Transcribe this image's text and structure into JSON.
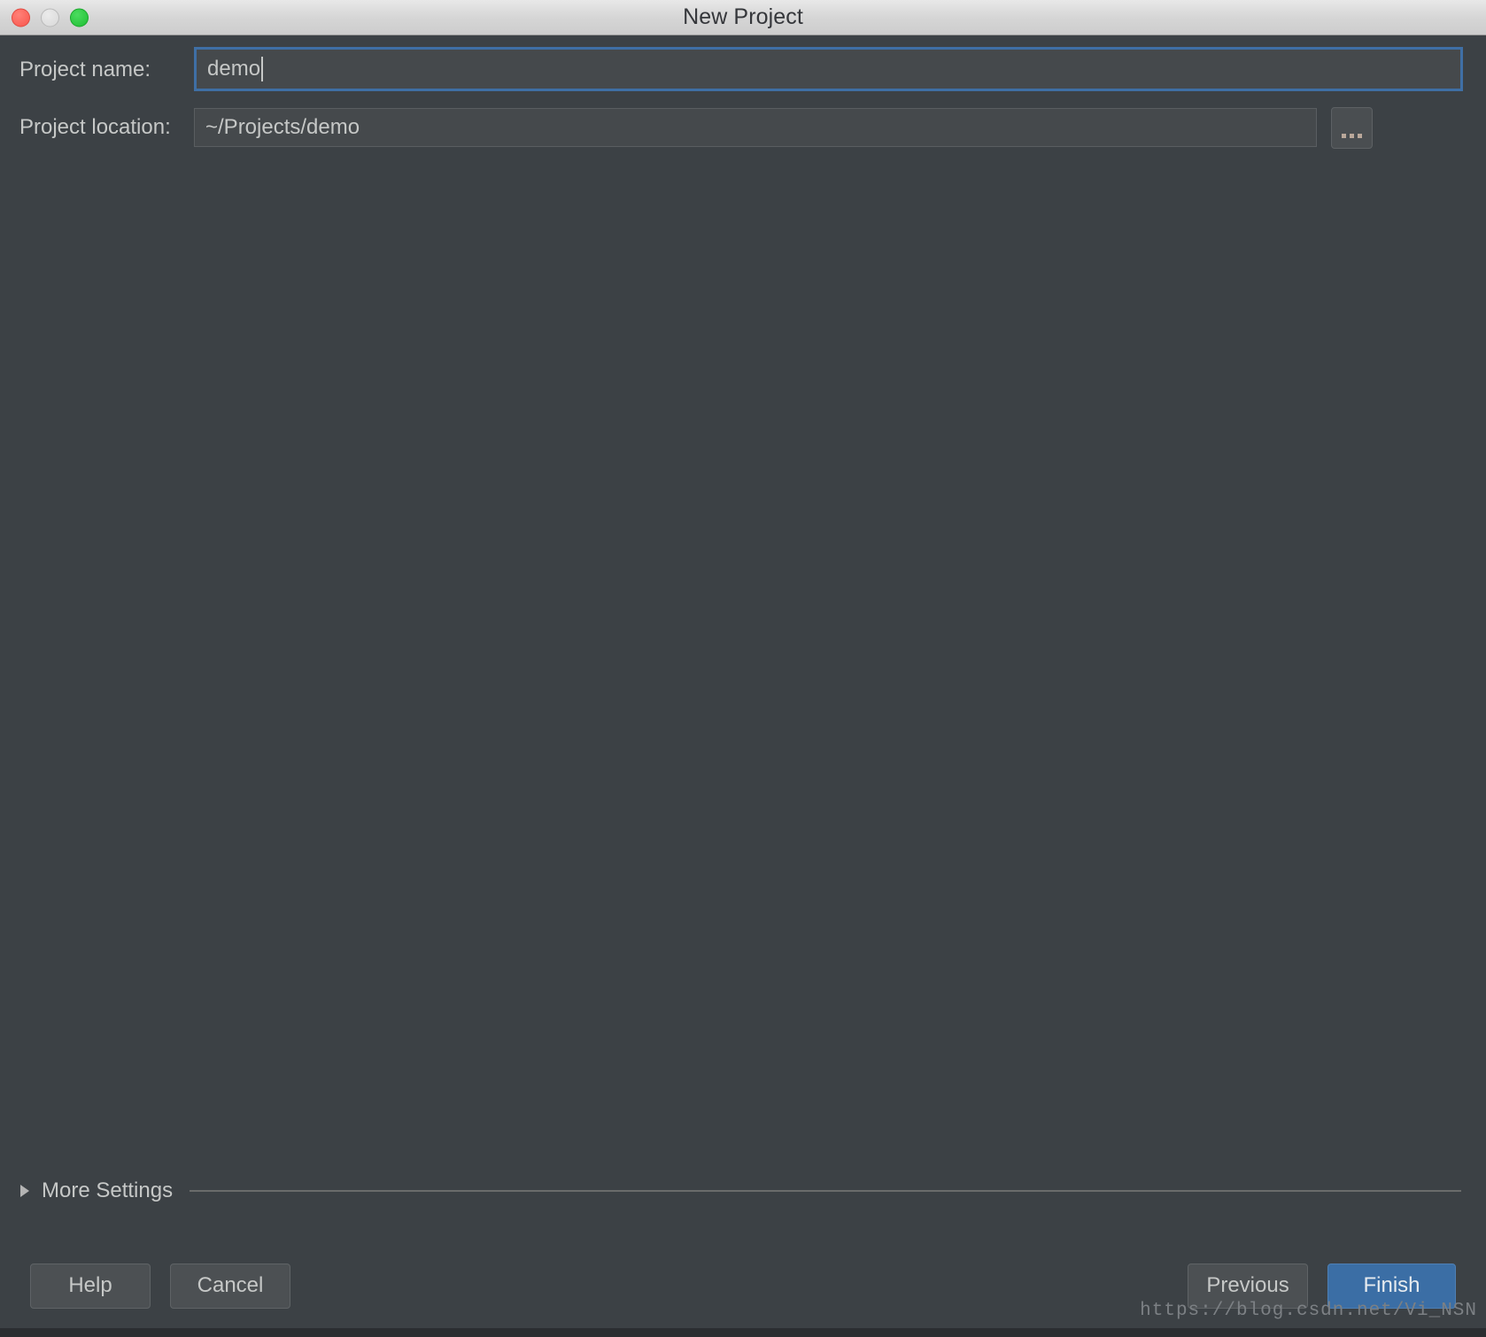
{
  "window": {
    "title": "New Project",
    "traffic_lights": {
      "close_color": "#f9564c",
      "minimize_color": "#dcdcdc",
      "maximize_color": "#28c940"
    }
  },
  "form": {
    "project_name": {
      "label": "Project name:",
      "value": "demo",
      "placeholder": "",
      "focused": true
    },
    "project_location": {
      "label": "Project location:",
      "value": "~/Projects/demo",
      "placeholder": "",
      "browse_label": "..."
    }
  },
  "more_settings": {
    "label": "More Settings",
    "expanded": false
  },
  "buttons": {
    "help": "Help",
    "cancel": "Cancel",
    "previous": "Previous",
    "finish": "Finish"
  },
  "watermark": "https://blog.csdn.net/Vi_NSN",
  "colors": {
    "dialog_background": "#3c4145",
    "field_background": "#45494c",
    "focus_border": "#3f6fa5",
    "primary_button": "#3b6ea5",
    "text": "#c6c8c7"
  }
}
